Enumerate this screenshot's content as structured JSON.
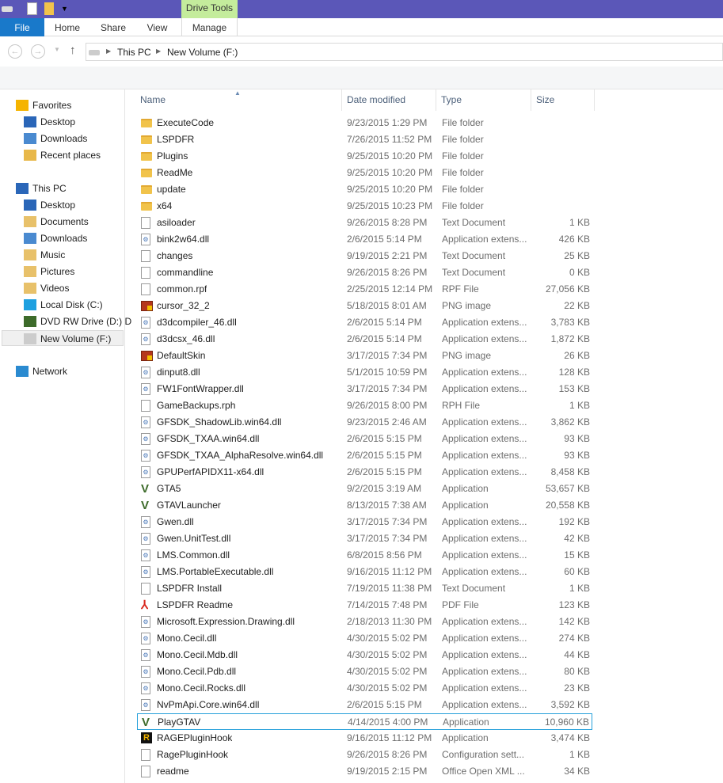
{
  "titlebar": {
    "context_tab": "Drive Tools"
  },
  "ribbon": {
    "tabs": [
      "File",
      "Home",
      "Share",
      "View",
      "Manage"
    ]
  },
  "address": {
    "crumbs": [
      "This PC",
      "New Volume (F:)"
    ]
  },
  "nav": {
    "favorites": "Favorites",
    "fav_items": [
      "Desktop",
      "Downloads",
      "Recent places"
    ],
    "this_pc": "This PC",
    "pc_items": [
      "Desktop",
      "Documents",
      "Downloads",
      "Music",
      "Pictures",
      "Videos",
      "Local Disk (C:)",
      "DVD RW Drive (D:) D",
      "New Volume (F:)"
    ],
    "network": "Network"
  },
  "columns": [
    "Name",
    "Date modified",
    "Type",
    "Size"
  ],
  "colors": {
    "accent": "#1979ca",
    "title": "#5b57b8",
    "context": "#c4ec9c",
    "selection": "#26a0da"
  },
  "files": [
    [
      "folder",
      "ExecuteCode",
      "9/23/2015 1:29 PM",
      "File folder",
      ""
    ],
    [
      "folder",
      "LSPDFR",
      "7/26/2015 11:52 PM",
      "File folder",
      ""
    ],
    [
      "folder",
      "Plugins",
      "9/25/2015 10:20 PM",
      "File folder",
      ""
    ],
    [
      "folder",
      "ReadMe",
      "9/25/2015 10:20 PM",
      "File folder",
      ""
    ],
    [
      "folder",
      "update",
      "9/25/2015 10:20 PM",
      "File folder",
      ""
    ],
    [
      "folder",
      "x64",
      "9/25/2015 10:23 PM",
      "File folder",
      ""
    ],
    [
      "text",
      "asiloader",
      "9/26/2015 8:28 PM",
      "Text Document",
      "1 KB"
    ],
    [
      "dll",
      "bink2w64.dll",
      "2/6/2015 5:14 PM",
      "Application extens...",
      "426 KB"
    ],
    [
      "text",
      "changes",
      "9/19/2015 2:21 PM",
      "Text Document",
      "25 KB"
    ],
    [
      "text",
      "commandline",
      "9/26/2015 8:26 PM",
      "Text Document",
      "0 KB"
    ],
    [
      "file",
      "common.rpf",
      "2/25/2015 12:14 PM",
      "RPF File",
      "27,056 KB"
    ],
    [
      "png",
      "cursor_32_2",
      "5/18/2015 8:01 AM",
      "PNG image",
      "22 KB"
    ],
    [
      "dll",
      "d3dcompiler_46.dll",
      "2/6/2015 5:14 PM",
      "Application extens...",
      "3,783 KB"
    ],
    [
      "dll",
      "d3dcsx_46.dll",
      "2/6/2015 5:14 PM",
      "Application extens...",
      "1,872 KB"
    ],
    [
      "png",
      "DefaultSkin",
      "3/17/2015 7:34 PM",
      "PNG image",
      "26 KB"
    ],
    [
      "dll",
      "dinput8.dll",
      "5/1/2015 10:59 PM",
      "Application extens...",
      "128 KB"
    ],
    [
      "dll",
      "FW1FontWrapper.dll",
      "3/17/2015 7:34 PM",
      "Application extens...",
      "153 KB"
    ],
    [
      "file",
      "GameBackups.rph",
      "9/26/2015 8:00 PM",
      "RPH File",
      "1 KB"
    ],
    [
      "dll",
      "GFSDK_ShadowLib.win64.dll",
      "9/23/2015 2:46 AM",
      "Application extens...",
      "3,862 KB"
    ],
    [
      "dll",
      "GFSDK_TXAA.win64.dll",
      "2/6/2015 5:15 PM",
      "Application extens...",
      "93 KB"
    ],
    [
      "dll",
      "GFSDK_TXAA_AlphaResolve.win64.dll",
      "2/6/2015 5:15 PM",
      "Application extens...",
      "93 KB"
    ],
    [
      "dll",
      "GPUPerfAPIDX11-x64.dll",
      "2/6/2015 5:15 PM",
      "Application extens...",
      "8,458 KB"
    ],
    [
      "gta",
      "GTA5",
      "9/2/2015 3:19 AM",
      "Application",
      "53,657 KB"
    ],
    [
      "gta",
      "GTAVLauncher",
      "8/13/2015 7:38 AM",
      "Application",
      "20,558 KB"
    ],
    [
      "dll",
      "Gwen.dll",
      "3/17/2015 7:34 PM",
      "Application extens...",
      "192 KB"
    ],
    [
      "dll",
      "Gwen.UnitTest.dll",
      "3/17/2015 7:34 PM",
      "Application extens...",
      "42 KB"
    ],
    [
      "dll",
      "LMS.Common.dll",
      "6/8/2015 8:56 PM",
      "Application extens...",
      "15 KB"
    ],
    [
      "dll",
      "LMS.PortableExecutable.dll",
      "9/16/2015 11:12 PM",
      "Application extens...",
      "60 KB"
    ],
    [
      "text",
      "LSPDFR Install",
      "7/19/2015 11:38 PM",
      "Text Document",
      "1 KB"
    ],
    [
      "pdf",
      "LSPDFR Readme",
      "7/14/2015 7:48 PM",
      "PDF File",
      "123 KB"
    ],
    [
      "dll",
      "Microsoft.Expression.Drawing.dll",
      "2/18/2013 11:30 PM",
      "Application extens...",
      "142 KB"
    ],
    [
      "dll",
      "Mono.Cecil.dll",
      "4/30/2015 5:02 PM",
      "Application extens...",
      "274 KB"
    ],
    [
      "dll",
      "Mono.Cecil.Mdb.dll",
      "4/30/2015 5:02 PM",
      "Application extens...",
      "44 KB"
    ],
    [
      "dll",
      "Mono.Cecil.Pdb.dll",
      "4/30/2015 5:02 PM",
      "Application extens...",
      "80 KB"
    ],
    [
      "dll",
      "Mono.Cecil.Rocks.dll",
      "4/30/2015 5:02 PM",
      "Application extens...",
      "23 KB"
    ],
    [
      "dll",
      "NvPmApi.Core.win64.dll",
      "2/6/2015 5:15 PM",
      "Application extens...",
      "3,592 KB"
    ],
    [
      "gta",
      "PlayGTAV",
      "4/14/2015 4:00 PM",
      "Application",
      "10,960 KB"
    ],
    [
      "rage",
      "RAGEPluginHook",
      "9/16/2015 11:12 PM",
      "Application",
      "3,474 KB"
    ],
    [
      "text",
      "RagePluginHook",
      "9/26/2015 8:26 PM",
      "Configuration sett...",
      "1 KB"
    ],
    [
      "text",
      "readme",
      "9/19/2015 2:15 PM",
      "Office Open XML ...",
      "34 KB"
    ]
  ],
  "selected_file": "PlayGTAV"
}
